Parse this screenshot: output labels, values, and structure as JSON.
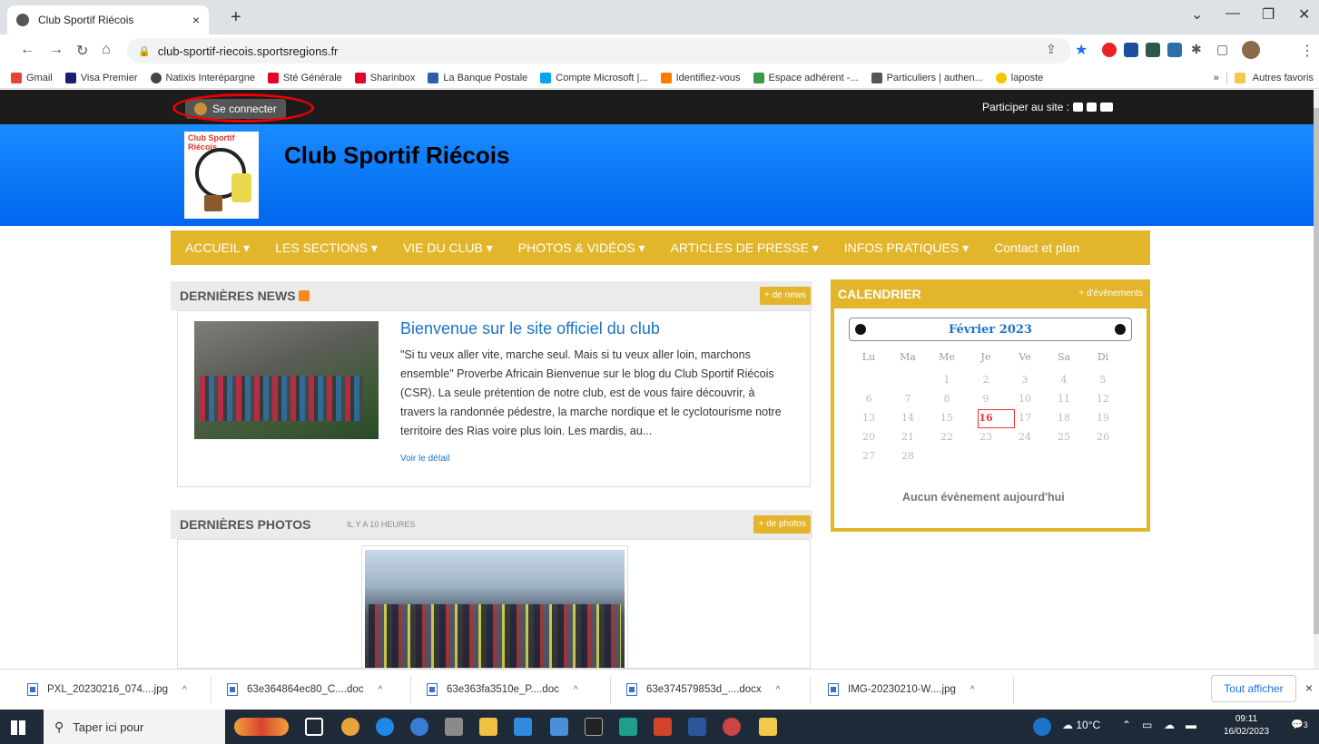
{
  "browser": {
    "tab_title": "Club Sportif Riécois",
    "tab_close": "×",
    "new_tab": "+",
    "url": "club-sportif-riecois.sportsregions.fr",
    "bookmarks": [
      {
        "label": "Gmail",
        "color": "#ea4335"
      },
      {
        "label": "Visa Premier",
        "color": "#1a1f71"
      },
      {
        "label": "Natixis Interépargne",
        "color": "#444444"
      },
      {
        "label": "Sté Générale",
        "color": "#e60028"
      },
      {
        "label": "Sharinbox",
        "color": "#e60028"
      },
      {
        "label": "La Banque Postale",
        "color": "#2c5fa8"
      },
      {
        "label": "Compte Microsoft |...",
        "color": "#00a4ef"
      },
      {
        "label": "Identifiez-vous",
        "color": "#ff7900"
      },
      {
        "label": "Espace adhérent -...",
        "color": "#3a9a4a"
      },
      {
        "label": "Particuliers | authen...",
        "color": "#555555"
      },
      {
        "label": "laposte",
        "color": "#f5c400"
      }
    ],
    "bookmarks_more": "»",
    "other_bookmarks": "Autres favoris"
  },
  "site": {
    "login_label": "Se connecter",
    "participate_label": "Participer au site :",
    "title": "Club Sportif Riécois",
    "logo_text": "Club Sportif Riécois",
    "nav": [
      "ACCUEIL ▾",
      "LES SECTIONS ▾",
      "VIE DU CLUB ▾",
      "PHOTOS & VIDÉOS ▾",
      "ARTICLES DE PRESSE ▾",
      "INFOS PRATIQUES ▾",
      "Contact et plan"
    ]
  },
  "news": {
    "heading": "DERNIÈRES NEWS",
    "more": "+ de news",
    "article_title": "Bienvenue sur le site officiel du club",
    "article_body": "\"Si tu veux aller vite, marche seul.  Mais si tu veux aller loin, marchons ensemble\" Proverbe Africain   Bienvenue sur le blog du Club Sportif Riécois (CSR). La seule prétention de notre club, est de vous faire découvrir, à travers la randonnée pédestre, la marche nordique et le cyclotourisme notre territoire des Rias voire plus loin. Les mardis, au...",
    "detail_link": "Voir le détail"
  },
  "photos": {
    "heading": "DERNIÈRES PHOTOS",
    "subheading": "IL Y A 10 HEURES",
    "more": "+ de photos"
  },
  "calendar": {
    "heading": "CALENDRIER",
    "more": "+ d'évènements",
    "month": "Février 2023",
    "weekdays": [
      "Lu",
      "Ma",
      "Me",
      "Je",
      "Ve",
      "Sa",
      "Di"
    ],
    "weeks": [
      [
        "",
        "",
        "1",
        "2",
        "3",
        "4",
        "5"
      ],
      [
        "6",
        "7",
        "8",
        "9",
        "10",
        "11",
        "12"
      ],
      [
        "13",
        "14",
        "15",
        "16",
        "17",
        "18",
        "19"
      ],
      [
        "20",
        "21",
        "22",
        "23",
        "24",
        "25",
        "26"
      ],
      [
        "27",
        "28",
        "",
        "",
        "",
        "",
        ""
      ]
    ],
    "today": "16",
    "no_event": "Aucun évènement aujourd'hui"
  },
  "downloads": {
    "items": [
      "PXL_20230216_074....jpg",
      "63e364864ec80_C....doc",
      "63e363fa3510e_P....doc",
      "63e374579853d_....docx",
      "IMG-20230210-W....jpg"
    ],
    "caret": "^",
    "show_all": "Tout afficher",
    "close": "×"
  },
  "taskbar": {
    "search_placeholder": "Taper ici pour",
    "weather": "10°C",
    "time": "09:11",
    "date": "16/02/2023",
    "notifications": "3"
  }
}
